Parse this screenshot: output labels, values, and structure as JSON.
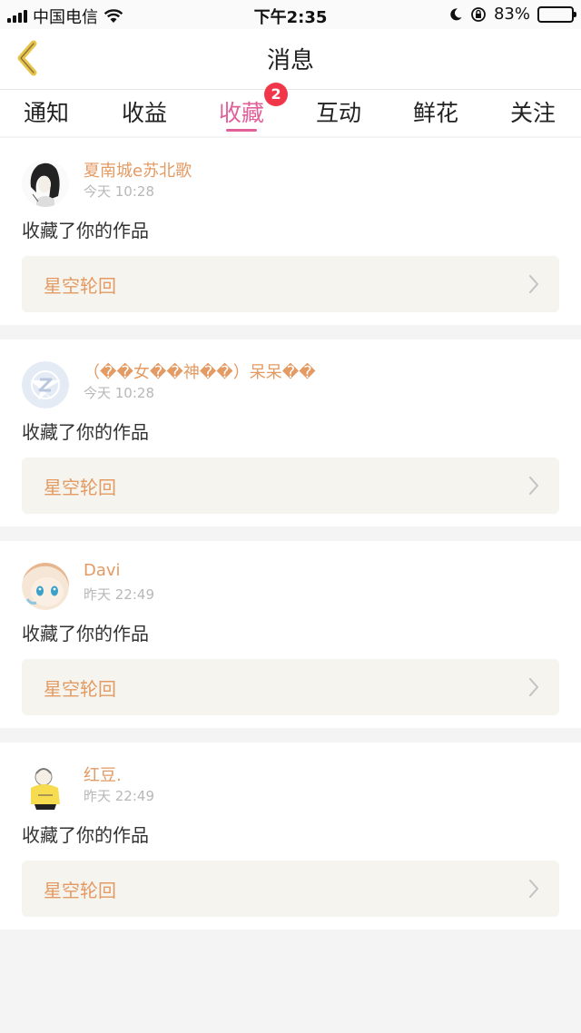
{
  "status_bar": {
    "carrier": "中国电信",
    "time": "下午2:35",
    "battery": "83%",
    "battery_level": 0.83
  },
  "nav": {
    "title": "消息",
    "back_icon": "chevron-left-icon",
    "back_color": "#e8c44b"
  },
  "tabs": [
    {
      "label": "通知"
    },
    {
      "label": "收益"
    },
    {
      "label": "收藏",
      "badge": "2",
      "active": true
    },
    {
      "label": "互动"
    },
    {
      "label": "鲜花"
    },
    {
      "label": "关注"
    }
  ],
  "messages": [
    {
      "user": "夏南城e苏北歌",
      "time": "今天 10:28",
      "action": "收藏了你的作品",
      "work": "星空轮回",
      "avatar_icon": "sketch-girl-avatar"
    },
    {
      "user": "（��女��神��）呆呆��",
      "time": "今天 10:28",
      "action": "收藏了你的作品",
      "work": "星空轮回",
      "avatar_icon": "default-z-avatar"
    },
    {
      "user": "Davi",
      "time": "昨天 22:49",
      "action": "收藏了你的作品",
      "work": "星空轮回",
      "avatar_icon": "anime-girl-avatar"
    },
    {
      "user": "红豆.",
      "time": "昨天 22:49",
      "action": "收藏了你的作品",
      "work": "星空轮回",
      "avatar_icon": "yellow-sweater-avatar"
    }
  ],
  "colors": {
    "accent": "#e0609a",
    "username": "#e39a63",
    "badge": "#f2364a",
    "work_box_bg": "#f5f4ee"
  }
}
